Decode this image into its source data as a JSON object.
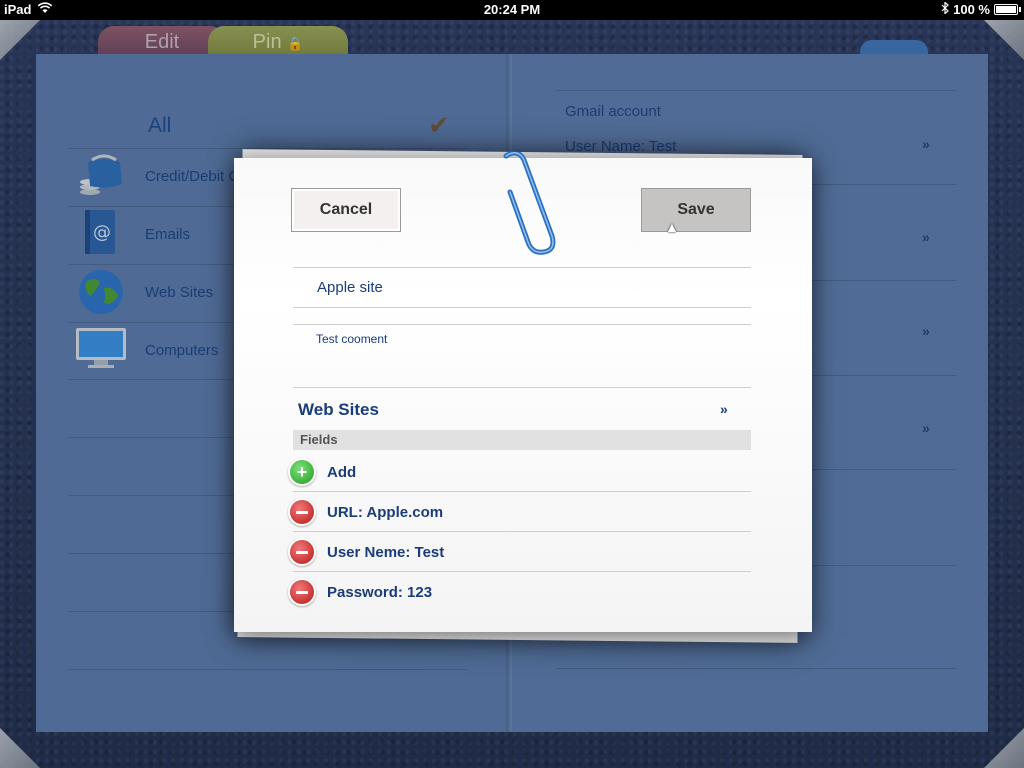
{
  "status_bar": {
    "device": "iPad",
    "time": "20:24 PM",
    "battery": "100 %"
  },
  "tabs": {
    "edit": "Edit",
    "pin": "Pin"
  },
  "left_page": {
    "all_label": "All",
    "categories": [
      {
        "label": "Credit/Debit C",
        "icon": "wallet-icon"
      },
      {
        "label": "Emails",
        "icon": "email-icon"
      },
      {
        "label": "Web Sites",
        "icon": "globe-icon"
      },
      {
        "label": "Computers",
        "icon": "monitor-icon"
      }
    ]
  },
  "right_page": {
    "entry_title": "Gmail account",
    "entry_subtitle": "User Name: Test"
  },
  "dialog": {
    "cancel_label": "Cancel",
    "save_label": "Save",
    "name_value": "Apple site",
    "comment_value": "Test cooment",
    "category_label": "Web Sites",
    "fields_header": "Fields",
    "add_label": "Add",
    "fields": [
      {
        "label": "URL: Apple.com"
      },
      {
        "label": "User Neme: Test"
      },
      {
        "label": "Password: 123"
      }
    ]
  },
  "colors": {
    "accent": "#1a3d7a",
    "page": "#5b7aaa",
    "add_green": "#1f9a1c",
    "remove_red": "#b81414"
  }
}
